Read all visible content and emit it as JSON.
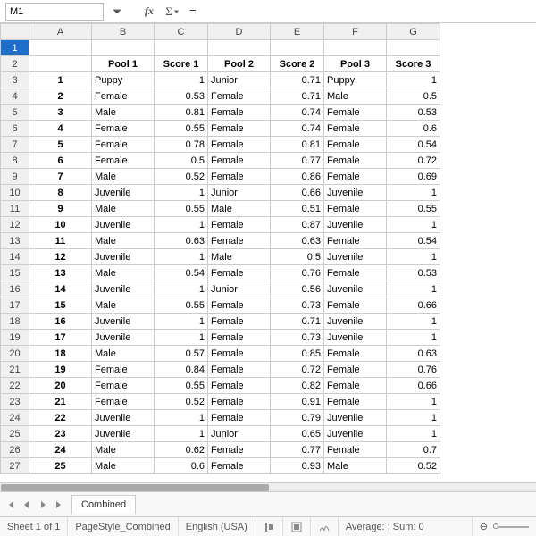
{
  "cellref": "M1",
  "cols": [
    "",
    "A",
    "B",
    "C",
    "D",
    "E",
    "F",
    "G"
  ],
  "headers": [
    "",
    "Pool 1",
    "Score 1",
    "Pool 2",
    "Score 2",
    "Pool 3",
    "Score 3"
  ],
  "rows": [
    [
      "1",
      "Puppy",
      "1",
      "Junior",
      "0.71",
      "Puppy",
      "1"
    ],
    [
      "2",
      "Female",
      "0.53",
      "Female",
      "0.71",
      "Male",
      "0.5"
    ],
    [
      "3",
      "Male",
      "0.81",
      "Female",
      "0.74",
      "Female",
      "0.53"
    ],
    [
      "4",
      "Female",
      "0.55",
      "Female",
      "0.74",
      "Female",
      "0.6"
    ],
    [
      "5",
      "Female",
      "0.78",
      "Female",
      "0.81",
      "Female",
      "0.54"
    ],
    [
      "6",
      "Female",
      "0.5",
      "Female",
      "0.77",
      "Female",
      "0.72"
    ],
    [
      "7",
      "Male",
      "0.52",
      "Female",
      "0.86",
      "Female",
      "0.69"
    ],
    [
      "8",
      "Juvenile",
      "1",
      "Junior",
      "0.66",
      "Juvenile",
      "1"
    ],
    [
      "9",
      "Male",
      "0.55",
      "Male",
      "0.51",
      "Female",
      "0.55"
    ],
    [
      "10",
      "Juvenile",
      "1",
      "Female",
      "0.87",
      "Juvenile",
      "1"
    ],
    [
      "11",
      "Male",
      "0.63",
      "Female",
      "0.63",
      "Female",
      "0.54"
    ],
    [
      "12",
      "Juvenile",
      "1",
      "Male",
      "0.5",
      "Juvenile",
      "1"
    ],
    [
      "13",
      "Male",
      "0.54",
      "Female",
      "0.76",
      "Female",
      "0.53"
    ],
    [
      "14",
      "Juvenile",
      "1",
      "Junior",
      "0.56",
      "Juvenile",
      "1"
    ],
    [
      "15",
      "Male",
      "0.55",
      "Female",
      "0.73",
      "Female",
      "0.66"
    ],
    [
      "16",
      "Juvenile",
      "1",
      "Female",
      "0.71",
      "Juvenile",
      "1"
    ],
    [
      "17",
      "Juvenile",
      "1",
      "Female",
      "0.73",
      "Juvenile",
      "1"
    ],
    [
      "18",
      "Male",
      "0.57",
      "Female",
      "0.85",
      "Female",
      "0.63"
    ],
    [
      "19",
      "Female",
      "0.84",
      "Female",
      "0.72",
      "Female",
      "0.76"
    ],
    [
      "20",
      "Female",
      "0.55",
      "Female",
      "0.82",
      "Female",
      "0.66"
    ],
    [
      "21",
      "Female",
      "0.52",
      "Female",
      "0.91",
      "Female",
      "1"
    ],
    [
      "22",
      "Juvenile",
      "1",
      "Female",
      "0.79",
      "Juvenile",
      "1"
    ],
    [
      "23",
      "Juvenile",
      "1",
      "Junior",
      "0.65",
      "Juvenile",
      "1"
    ],
    [
      "24",
      "Male",
      "0.62",
      "Female",
      "0.77",
      "Female",
      "0.7"
    ],
    [
      "25",
      "Male",
      "0.6",
      "Female",
      "0.93",
      "Male",
      "0.52"
    ]
  ],
  "tab": "Combined",
  "status": {
    "sheet": "Sheet 1 of 1",
    "style": "PageStyle_Combined",
    "lang": "English (USA)",
    "stats": "Average: ; Sum: 0"
  }
}
